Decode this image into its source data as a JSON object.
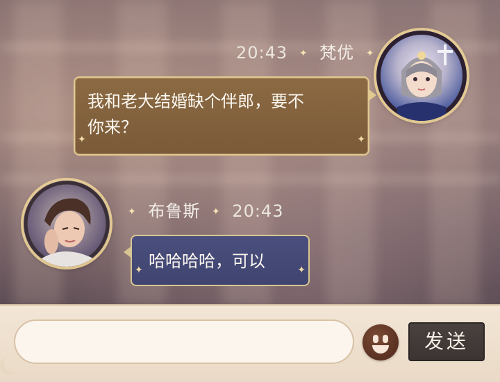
{
  "messages": [
    {
      "sender": "梵优",
      "time": "20:43",
      "text_line1": "我和老大结婚缺个伴郎，要不",
      "text_line2": "你来？",
      "avatar_icon": "girl-avatar-icon",
      "bubble_color": "#7f5f3c"
    },
    {
      "sender": "布鲁斯",
      "time": "20:43",
      "text": "哈哈哈哈，可以",
      "avatar_icon": "boy-avatar-icon",
      "bubble_color": "#444975"
    }
  ],
  "composer": {
    "input_value": "",
    "emoji_icon": "emoji-face-icon",
    "send_label": "发送"
  },
  "decoration": {
    "star_glyph": "✦"
  }
}
